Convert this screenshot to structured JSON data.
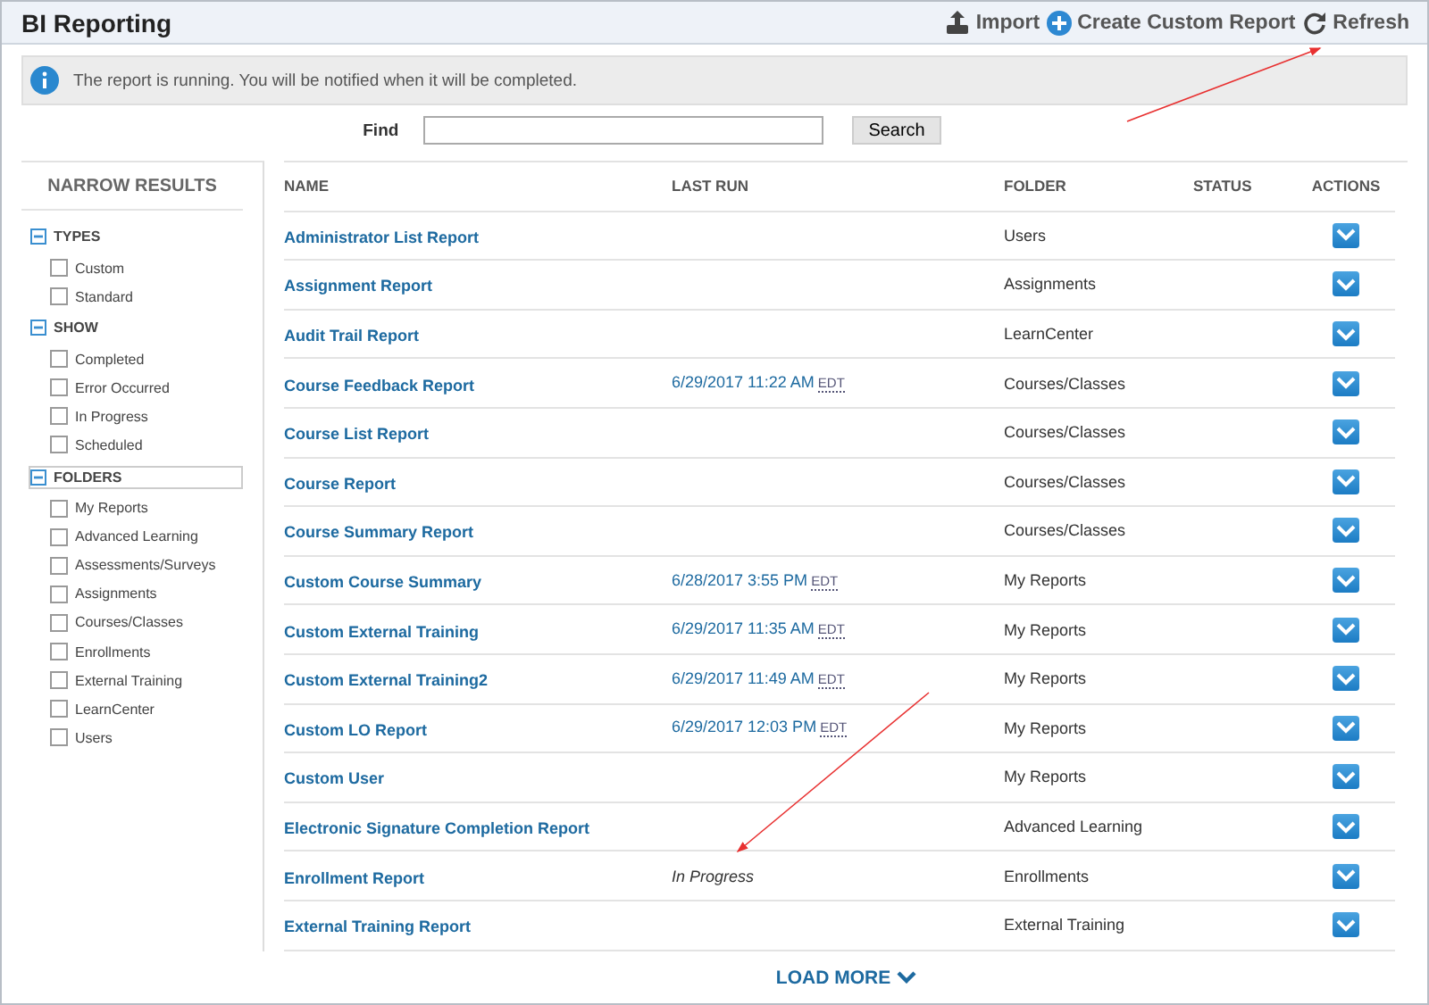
{
  "header": {
    "title": "BI Reporting",
    "actions": [
      {
        "kind": "import",
        "label": "Import"
      },
      {
        "kind": "create",
        "label": "Create Custom Report"
      },
      {
        "kind": "refresh",
        "label": "Refresh"
      }
    ]
  },
  "notice": {
    "text": "The report is running. You will be notified when it will be completed."
  },
  "find": {
    "label": "Find",
    "button": "Search"
  },
  "sidebar": {
    "title": "NARROW RESULTS",
    "groups": [
      {
        "title": "TYPES",
        "expanded": true,
        "focused": false,
        "items": [
          {
            "label": "Custom",
            "checked": false
          },
          {
            "label": "Standard",
            "checked": false
          }
        ]
      },
      {
        "title": "SHOW",
        "expanded": true,
        "focused": false,
        "items": [
          {
            "label": "Completed",
            "checked": false
          },
          {
            "label": "Error Occurred",
            "checked": false
          },
          {
            "label": "In Progress",
            "checked": false
          },
          {
            "label": "Scheduled",
            "checked": false
          }
        ]
      },
      {
        "title": "FOLDERS",
        "expanded": true,
        "focused": true,
        "items": [
          {
            "label": "My Reports",
            "checked": false
          },
          {
            "label": "Advanced Learning",
            "checked": false
          },
          {
            "label": "Assessments/Surveys",
            "checked": false
          },
          {
            "label": "Assignments",
            "checked": false
          },
          {
            "label": "Courses/Classes",
            "checked": false
          },
          {
            "label": "Enrollments",
            "checked": false
          },
          {
            "label": "External Training",
            "checked": false
          },
          {
            "label": "LearnCenter",
            "checked": false
          },
          {
            "label": "Users",
            "checked": false
          }
        ]
      }
    ]
  },
  "table": {
    "columns": [
      "NAME",
      "LAST RUN",
      "FOLDER",
      "STATUS",
      "ACTIONS"
    ],
    "rows": [
      {
        "name": "Administrator List Report",
        "folder": "Users"
      },
      {
        "name": "Assignment Report",
        "folder": "Assignments"
      },
      {
        "name": "Audit Trail Report",
        "folder": "LearnCenter"
      },
      {
        "name": "Course Feedback Report",
        "last_run": {
          "kind": "date",
          "text": "6/29/2017 11:22 AM",
          "zone": "EDT"
        },
        "folder": "Courses/Classes"
      },
      {
        "name": "Course List Report",
        "folder": "Courses/Classes"
      },
      {
        "name": "Course Report",
        "folder": "Courses/Classes"
      },
      {
        "name": "Course Summary Report",
        "folder": "Courses/Classes"
      },
      {
        "name": "Custom Course Summary",
        "last_run": {
          "kind": "date",
          "text": "6/28/2017 3:55 PM",
          "zone": "EDT"
        },
        "folder": "My Reports"
      },
      {
        "name": "Custom External Training",
        "last_run": {
          "kind": "date",
          "text": "6/29/2017 11:35 AM",
          "zone": "EDT"
        },
        "folder": "My Reports"
      },
      {
        "name": "Custom External Training2",
        "last_run": {
          "kind": "date",
          "text": "6/29/2017 11:49 AM",
          "zone": "EDT"
        },
        "folder": "My Reports"
      },
      {
        "name": "Custom LO Report",
        "last_run": {
          "kind": "date",
          "text": "6/29/2017 12:03 PM",
          "zone": "EDT"
        },
        "folder": "My Reports"
      },
      {
        "name": "Custom User",
        "folder": "My Reports"
      },
      {
        "name": "Electronic Signature Completion Report",
        "folder": "Advanced Learning"
      },
      {
        "name": "Enrollment Report",
        "last_run": {
          "kind": "status",
          "text": "In Progress"
        },
        "folder": "Enrollments"
      },
      {
        "name": "External Training Report",
        "folder": "External Training"
      }
    ]
  },
  "load_more": "LOAD MORE"
}
